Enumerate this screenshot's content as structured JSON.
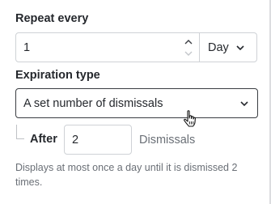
{
  "repeat": {
    "label": "Repeat every",
    "value": "1",
    "unit": "Day"
  },
  "expiration": {
    "label": "Expiration type",
    "selected": "A set number of dismissals"
  },
  "after": {
    "label": "After",
    "value": "2",
    "suffix": "Dismissals"
  },
  "help_text": "Displays at most once a day until it is dismissed 2 times.",
  "icons": {
    "stepper_up": "chevron-up-icon",
    "stepper_down": "chevron-down-icon",
    "select_chevron": "chevron-down-icon",
    "cursor": "hand-pointer-cursor-icon"
  },
  "colors": {
    "text": "#25282d",
    "muted": "#6a6f76",
    "border": "#cfd2d6",
    "focused_border": "#3a3d42"
  }
}
